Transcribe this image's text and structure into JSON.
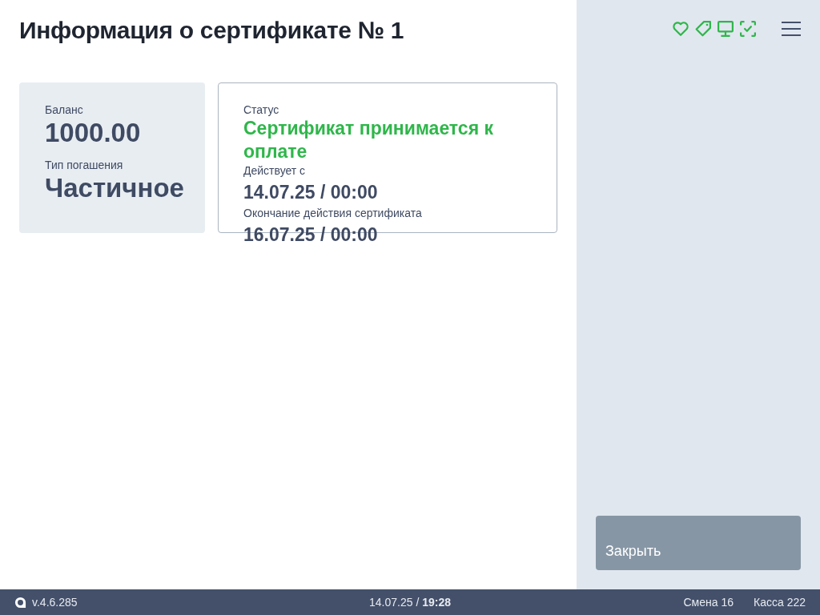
{
  "header": {
    "title": "Информация о сертификате № 1"
  },
  "balance_card": {
    "fields": [
      {
        "label": "Баланс",
        "value": "1000.00"
      },
      {
        "label": "Тип погашения",
        "value": "Частичное"
      }
    ]
  },
  "status_card": {
    "fields": [
      {
        "kind": "status",
        "label": "Статус",
        "value": "Сертификат принимается к оплате"
      },
      {
        "kind": "date",
        "label": "Действует с",
        "value": "14.07.25 / 00:00"
      },
      {
        "kind": "date",
        "label": "Окончание действия сертификата",
        "value": "16.07.25 / 00:00"
      }
    ]
  },
  "sidebar": {
    "close_button": "Закрыть"
  },
  "status_bar": {
    "version": "v.4.6.285",
    "datetime": "14.07.25 / **19:28**",
    "shift": "Смена 16",
    "register": "Касса 222"
  }
}
